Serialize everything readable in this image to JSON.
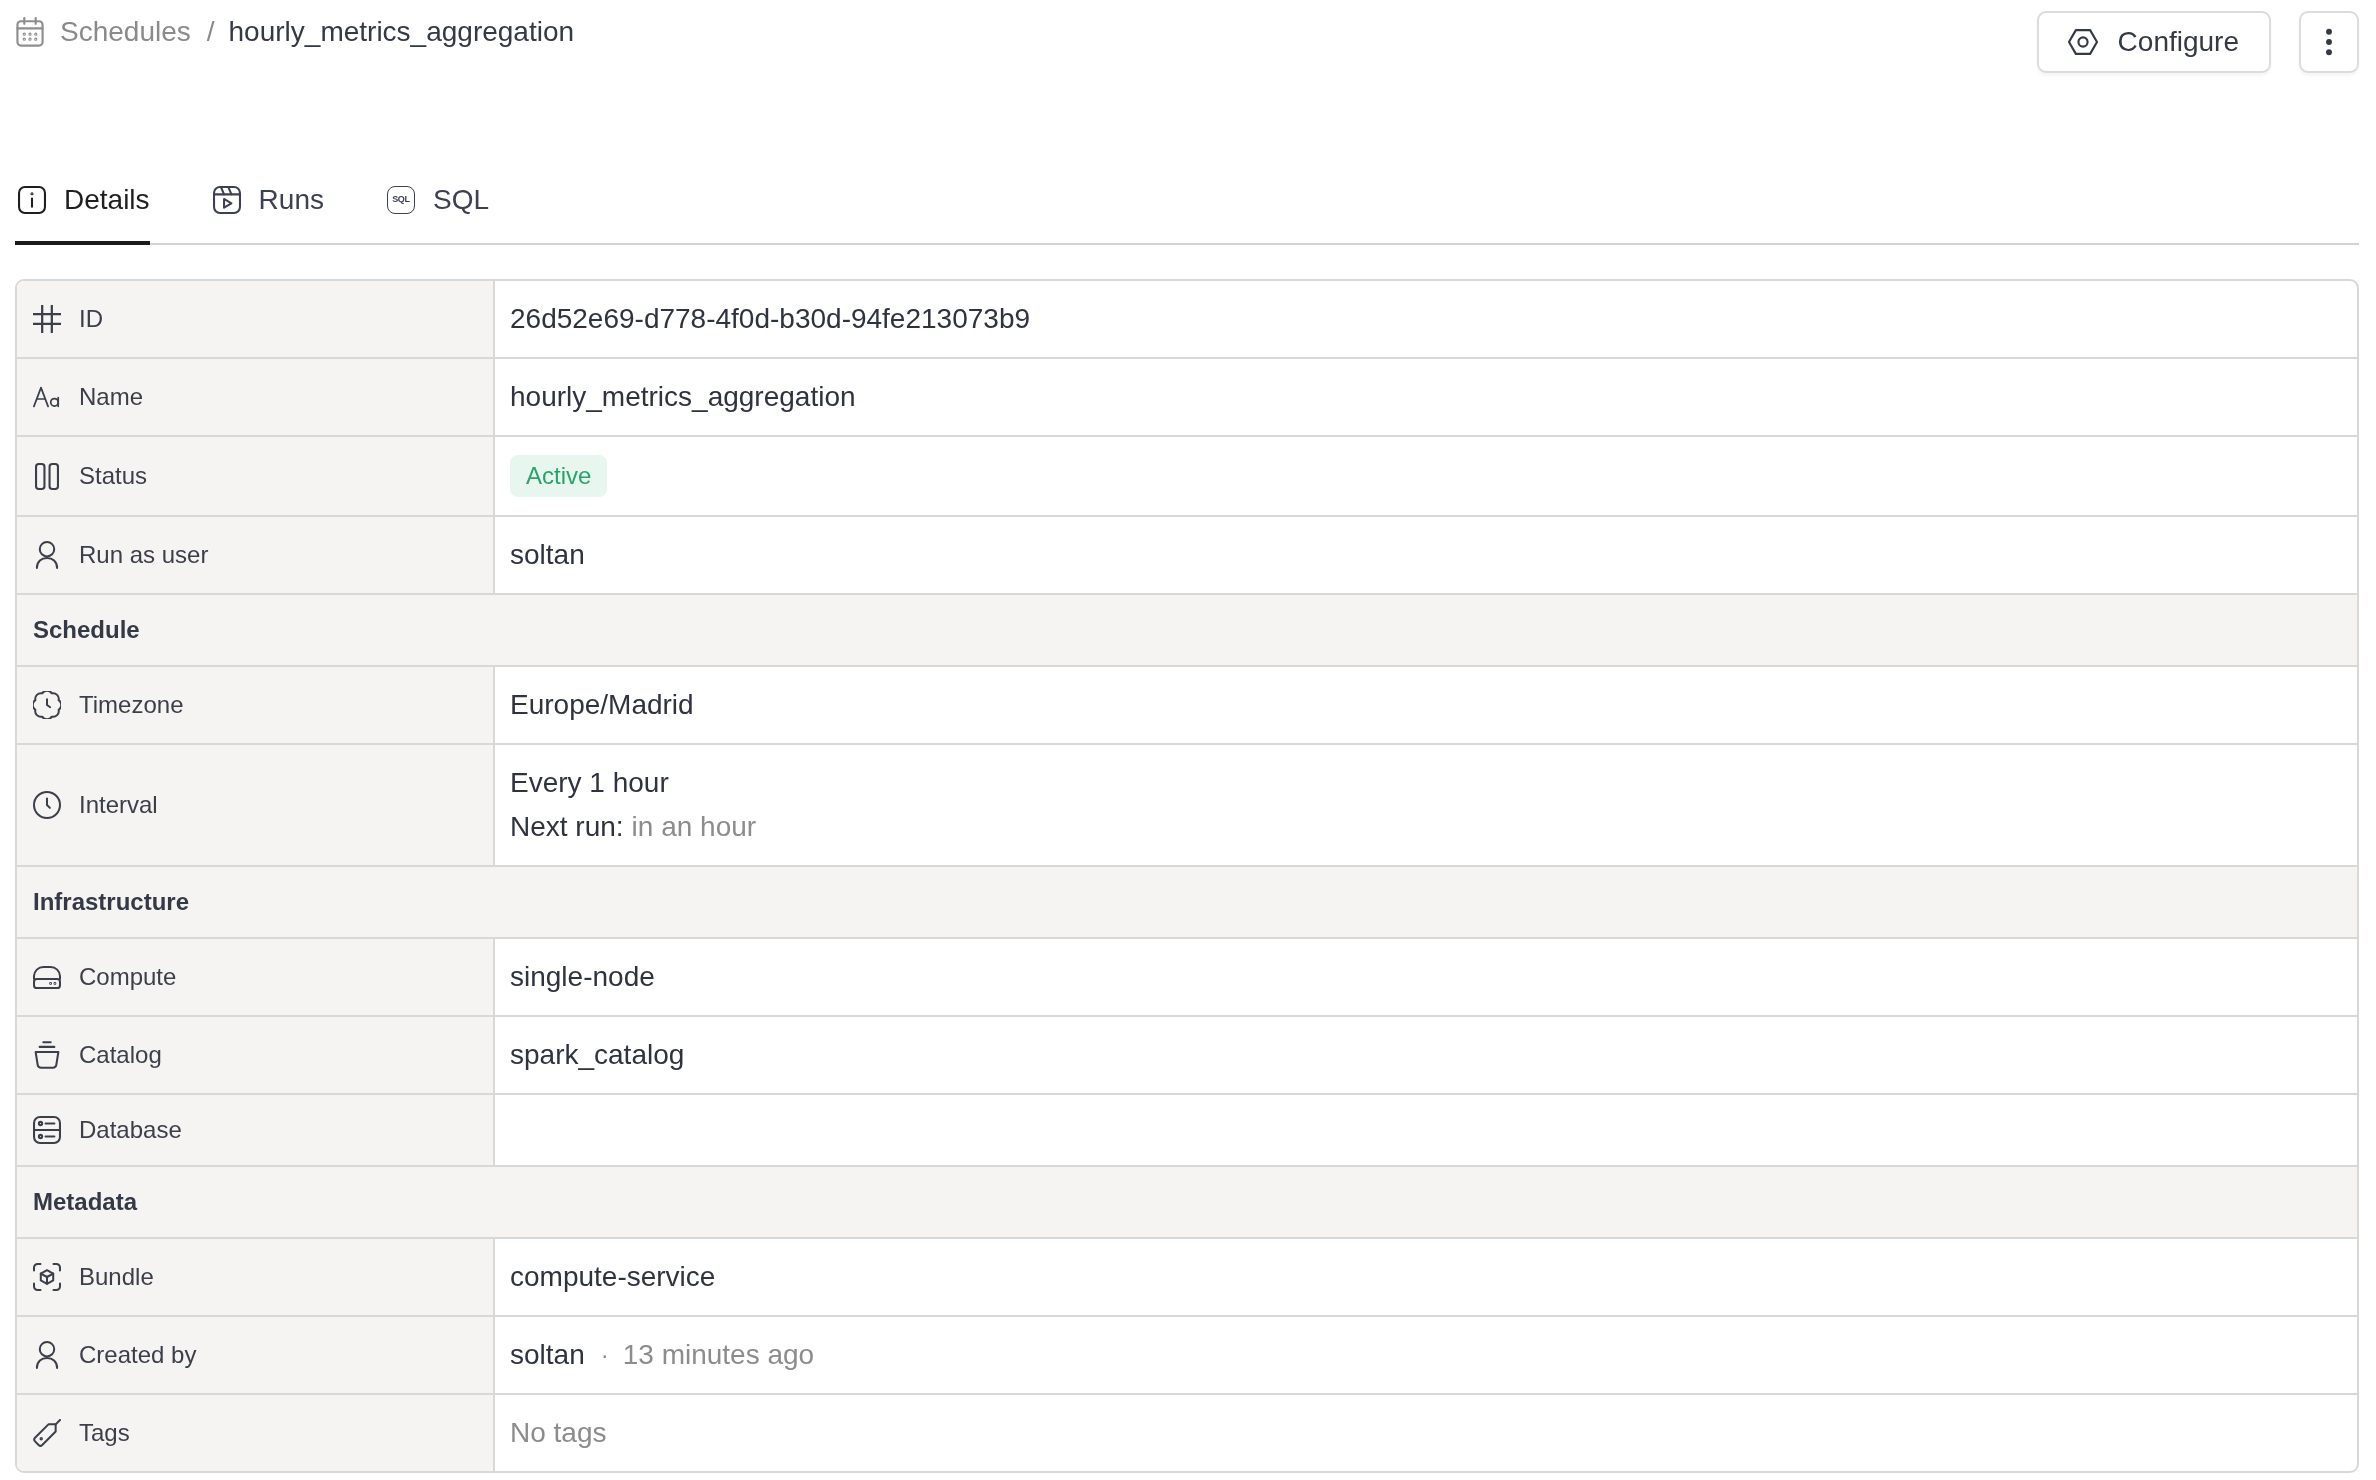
{
  "breadcrumb": {
    "parent": "Schedules",
    "separator": "/",
    "current": "hourly_metrics_aggregation"
  },
  "actions": {
    "configure": "Configure"
  },
  "tabs": [
    {
      "label": "Details",
      "selected": true
    },
    {
      "label": "Runs",
      "selected": false
    },
    {
      "label": "SQL",
      "selected": false,
      "icon_text": "SQL"
    }
  ],
  "details": [
    {
      "kind": "field",
      "label": "ID",
      "value": "26d52e69-d778-4f0d-b30d-94fe213073b9"
    },
    {
      "kind": "field",
      "label": "Name",
      "value": "hourly_metrics_aggregation"
    },
    {
      "kind": "badge",
      "label": "Status",
      "value": "Active"
    },
    {
      "kind": "field",
      "label": "Run as user",
      "value": "soltan"
    },
    {
      "kind": "section",
      "title": "Schedule"
    },
    {
      "kind": "field",
      "label": "Timezone",
      "value": "Europe/Madrid"
    },
    {
      "kind": "schedule",
      "label": "Interval",
      "value": "Every 1 hour",
      "next_label": "Next run:",
      "next_value": "in an hour"
    },
    {
      "kind": "section",
      "title": "Infrastructure"
    },
    {
      "kind": "field",
      "label": "Compute",
      "value": "single-node"
    },
    {
      "kind": "field",
      "label": "Catalog",
      "value": "spark_catalog"
    },
    {
      "kind": "field",
      "label": "Database"
    },
    {
      "kind": "section",
      "title": "Metadata"
    },
    {
      "kind": "field",
      "label": "Bundle",
      "value": "compute-service"
    },
    {
      "kind": "byline",
      "label": "Created by",
      "value": "soltan",
      "separator": "·",
      "time": "13 minutes ago"
    },
    {
      "kind": "empty",
      "label": "Tags",
      "value": "No tags"
    }
  ]
}
